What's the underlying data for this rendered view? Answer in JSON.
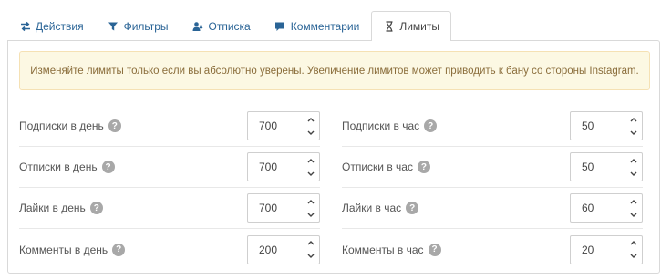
{
  "tabs": [
    {
      "label": "Действия",
      "icon": "exchange-arrows-icon"
    },
    {
      "label": "Фильтры",
      "icon": "filter-icon"
    },
    {
      "label": "Отписка",
      "icon": "user-remove-icon"
    },
    {
      "label": "Комментарии",
      "icon": "comment-icon"
    },
    {
      "label": "Лимиты",
      "icon": "hourglass-icon",
      "active": true
    }
  ],
  "alert": {
    "text": "Изменяйте лимиты только если вы абсолютно уверены. Увеличение лимитов может приводить к бану со стороны Instagram."
  },
  "limits": {
    "left": [
      {
        "label": "Подписки в день",
        "value": "700"
      },
      {
        "label": "Отписки в день",
        "value": "700"
      },
      {
        "label": "Лайки в день",
        "value": "700"
      },
      {
        "label": "Комменты в день",
        "value": "200"
      }
    ],
    "right": [
      {
        "label": "Подписки в час",
        "value": "50"
      },
      {
        "label": "Отписки в час",
        "value": "50"
      },
      {
        "label": "Лайки в час",
        "value": "60"
      },
      {
        "label": "Комменты в час",
        "value": "20"
      }
    ]
  },
  "help_symbol": "?",
  "colors": {
    "link": "#2a6496",
    "alert_bg": "#fcf8e3",
    "alert_text": "#8a6d3b",
    "help_bg": "#a8a8a8"
  }
}
